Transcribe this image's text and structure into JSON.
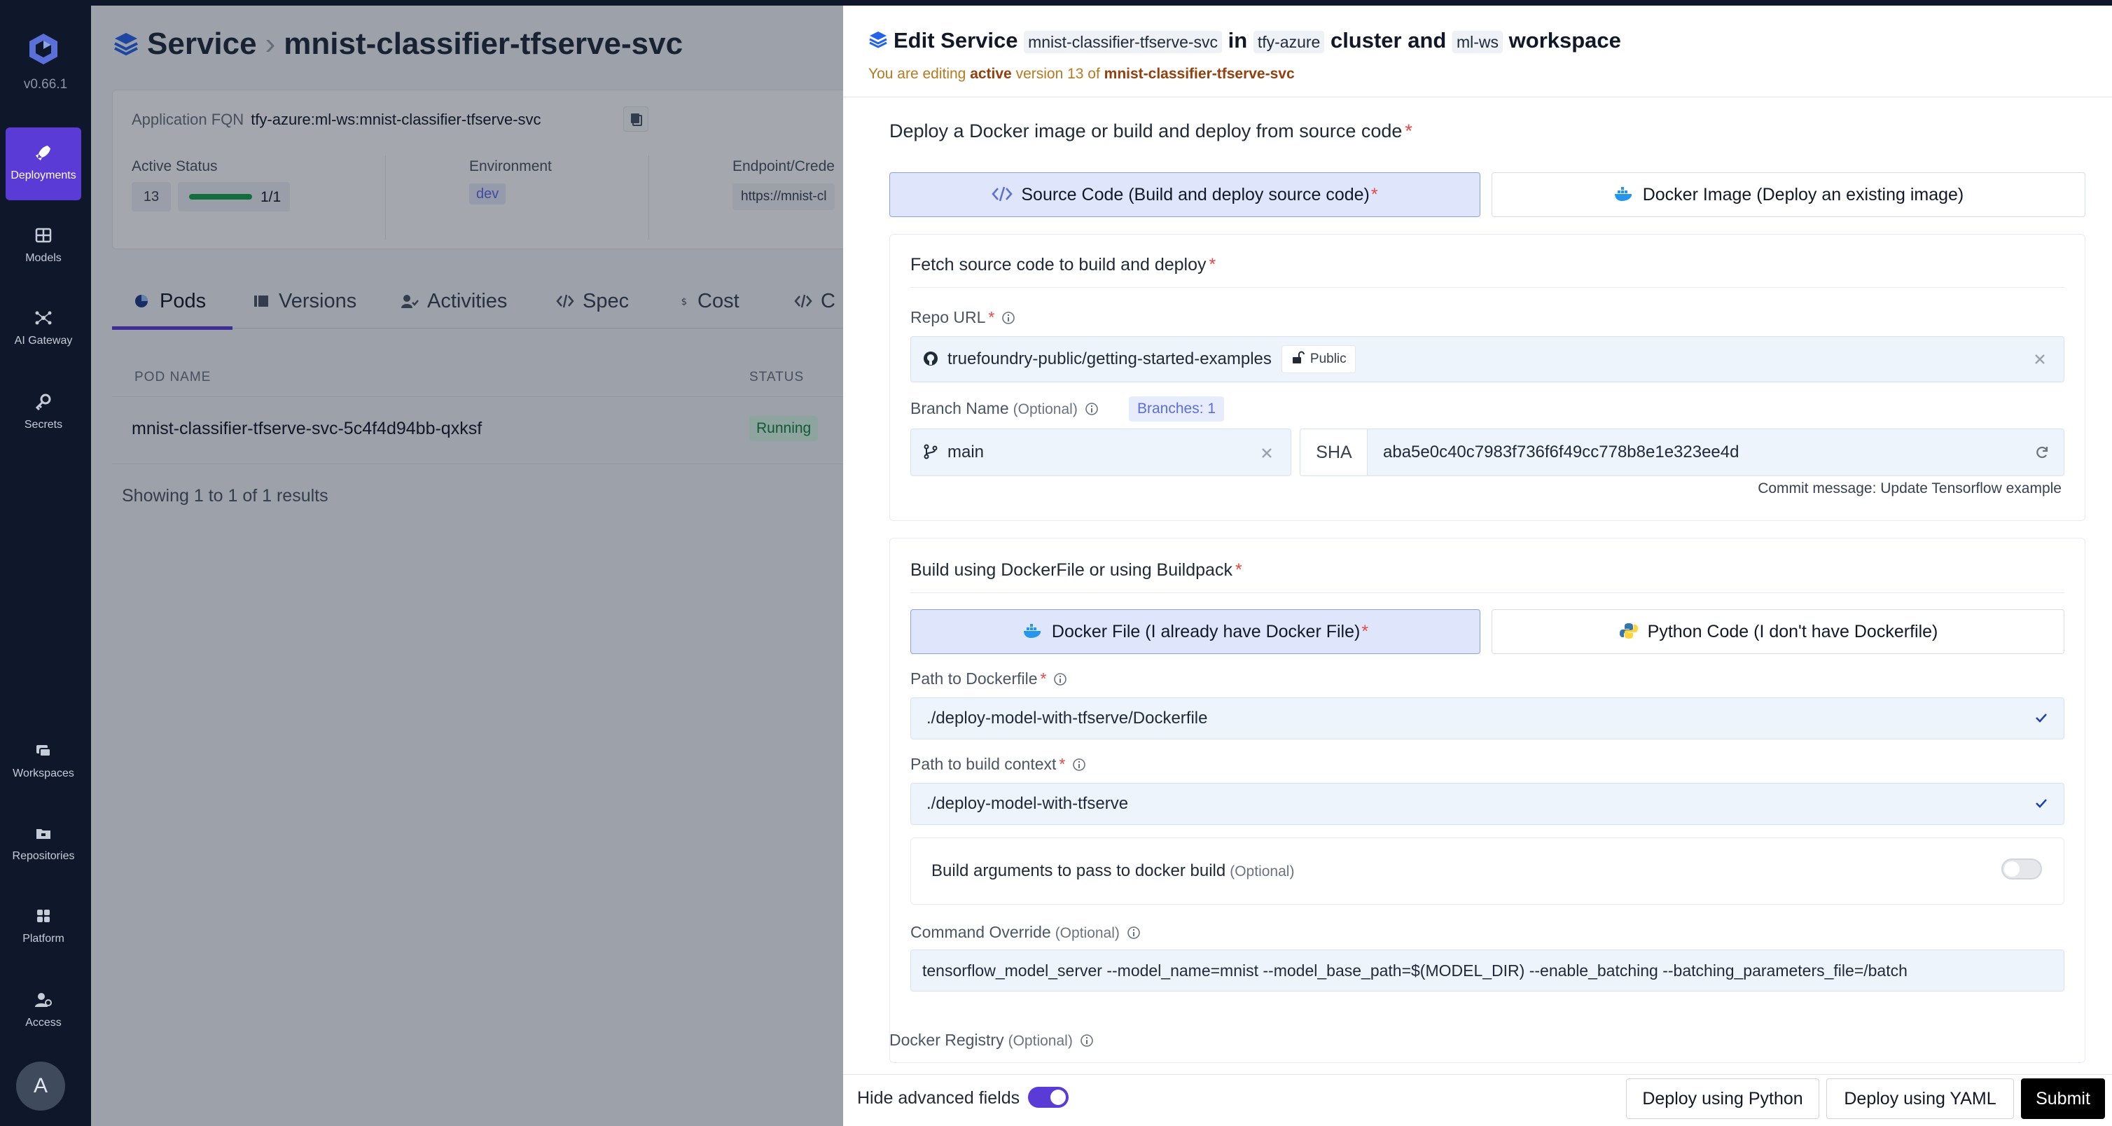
{
  "sidebar": {
    "version": "v0.66.1",
    "items": [
      {
        "label": "Deployments",
        "icon": "rocket-icon",
        "active": true
      },
      {
        "label": "Models",
        "icon": "grid-icon"
      },
      {
        "label": "AI Gateway",
        "icon": "gateway-icon"
      },
      {
        "label": "Secrets",
        "icon": "key-icon"
      },
      {
        "label": "Workspaces",
        "icon": "workspaces-icon"
      },
      {
        "label": "Repositories",
        "icon": "repository-icon"
      },
      {
        "label": "Platform",
        "icon": "platform-icon"
      },
      {
        "label": "Access",
        "icon": "access-icon"
      }
    ],
    "avatar": "A"
  },
  "background": {
    "breadcrumb_root": "Service",
    "breadcrumb_sep": "›",
    "service_name": "mnist-classifier-tfserve-svc",
    "fqn_label": "Application FQN",
    "fqn_value": "tfy-azure:ml-ws:mnist-classifier-tfserve-svc",
    "active_status_label": "Active Status",
    "active_version": "13",
    "replicas": "1/1",
    "replicas_ready_fraction": 1.0,
    "environment_label": "Environment",
    "environment_value": "dev",
    "endpoint_label": "Endpoint/Crede",
    "endpoint_value": "https://mnist-cl",
    "tabs": [
      "Pods",
      "Versions",
      "Activities",
      "Spec",
      "Cost",
      "C"
    ],
    "table_headers": {
      "pod_name": "POD NAME",
      "status": "STATUS"
    },
    "pod_row": {
      "name": "mnist-classifier-tfserve-svc-5c4f4d94bb-qxksf",
      "status": "Running"
    },
    "showing": "Showing 1 to 1 of 1 results"
  },
  "drawer": {
    "title_prefix": "Edit Service",
    "service_name": "mnist-classifier-tfserve-svc",
    "in_word": "in",
    "cluster": "tfy-azure",
    "cluster_word": "cluster and",
    "workspace": "ml-ws",
    "workspace_word": "workspace",
    "editing_prefix": "You are editing",
    "editing_state": "active",
    "editing_version_text": "version 13 of",
    "editing_service": "mnist-classifier-tfserve-svc",
    "deploy_section_label": "Deploy a Docker image or build and deploy from source code",
    "option_source": "Source Code (Build and deploy source code)",
    "option_docker": "Docker Image (Deploy an existing image)",
    "fetch_label": "Fetch source code to build and deploy",
    "repo_url_label": "Repo URL",
    "repo_url_value": "truefoundry-public/getting-started-examples",
    "repo_visibility": "Public",
    "branch_label": "Branch Name",
    "optional": "(Optional)",
    "branches_badge": "Branches: 1",
    "branch_value": "main",
    "sha_label": "SHA",
    "sha_value": "aba5e0c40c7983f736f6f49cc778b8e1e323ee4d",
    "commit_message": "Commit message: Update Tensorflow example",
    "build_label": "Build using DockerFile or using Buildpack",
    "build_option_dockerfile": "Docker File (I already have Docker File)",
    "build_option_python": "Python Code (I don't have Dockerfile)",
    "dockerfile_path_label": "Path to Dockerfile",
    "dockerfile_path_value": "./deploy-model-with-tfserve/Dockerfile",
    "build_context_label": "Path to build context",
    "build_context_value": "./deploy-model-with-tfserve",
    "build_args_label": "Build arguments to pass to docker build",
    "build_args_enabled": false,
    "command_override_label": "Command Override",
    "command_override_value": "tensorflow_model_server --model_name=mnist --model_base_path=$(MODEL_DIR) --enable_batching --batching_parameters_file=/batch",
    "docker_registry_label": "Docker Registry",
    "hide_advanced_label": "Hide advanced fields",
    "hide_advanced_enabled": true,
    "btn_python": "Deploy using Python",
    "btn_yaml": "Deploy using YAML",
    "btn_submit": "Submit"
  },
  "colors": {
    "accent": "#5b3bd6",
    "required": "#ef4444",
    "warning_text": "#b7791f",
    "success": "#16a34a"
  }
}
